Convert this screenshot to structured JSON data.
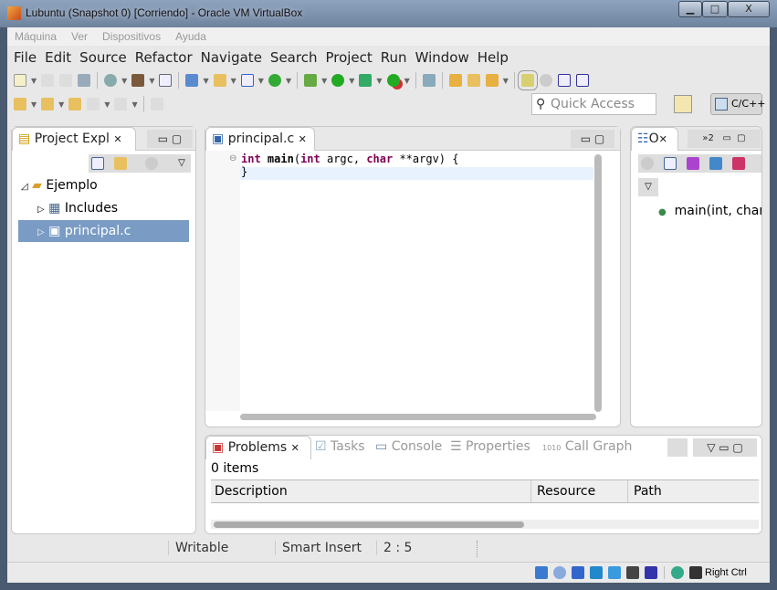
{
  "window": {
    "title": "Lubuntu (Snapshot 0) [Corriendo] - Oracle VM VirtualBox",
    "minimize": "▁",
    "maximize": "□",
    "close": "X"
  },
  "vbox_menu": [
    "Máquina",
    "Ver",
    "Dispositivos",
    "Ayuda"
  ],
  "eclipse_menu": [
    "File",
    "Edit",
    "Source",
    "Refactor",
    "Navigate",
    "Search",
    "Project",
    "Run",
    "Window",
    "Help"
  ],
  "quick_access": {
    "placeholder": "Quick Access"
  },
  "perspective": {
    "label": "C/C++"
  },
  "project_explorer": {
    "tab": "Project Expl",
    "tree": [
      {
        "label": "Ejemplo",
        "expanded": true
      },
      {
        "label": "Includes"
      },
      {
        "label": "principal.c",
        "selected": true
      }
    ]
  },
  "editor": {
    "tab": "principal.c",
    "lines": [
      {
        "kw1": "int",
        "fn": "main",
        "p1": "(",
        "kw2": "int",
        "mid": " argc, ",
        "kw3": "char",
        "rest": " **argv) {"
      },
      "",
      "}"
    ]
  },
  "outline": {
    "tab": "O",
    "overflow": "»2",
    "items": [
      "main(int, char"
    ]
  },
  "problems": {
    "tabs": [
      "Problems",
      "Tasks",
      "Console",
      "Properties",
      "Call Graph"
    ],
    "count": "0 items",
    "columns": [
      "Description",
      "Resource",
      "Path"
    ]
  },
  "status_bar": {
    "mode": "Writable",
    "insert": "Smart Insert",
    "position": "2 : 5"
  },
  "vbox_status": {
    "host_key": "Right Ctrl"
  }
}
